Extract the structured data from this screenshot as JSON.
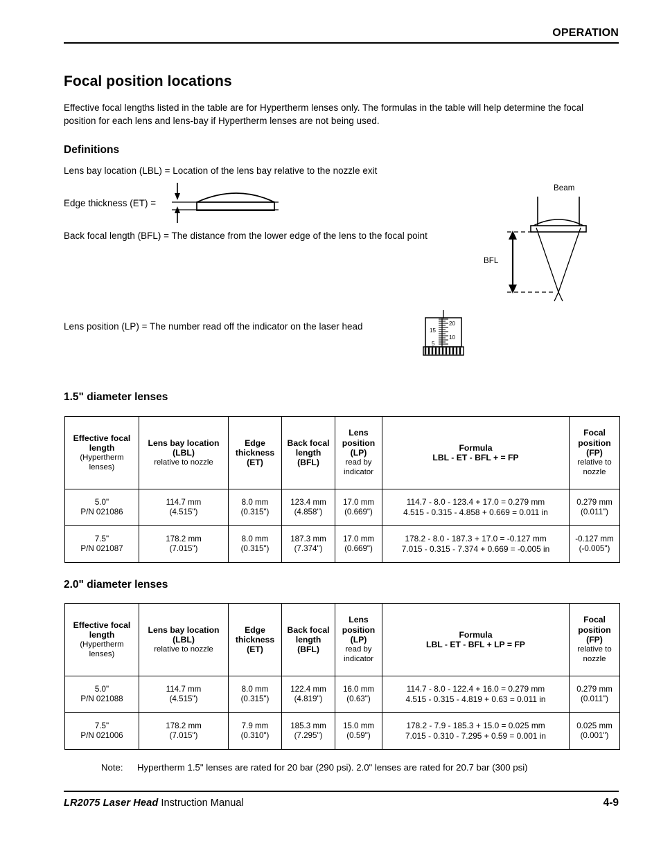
{
  "header": {
    "section_title": "OPERATION"
  },
  "titles": {
    "h1": "Focal position locations",
    "definitions": "Definitions",
    "table1_heading": "1.5\" diameter lenses",
    "table2_heading": "2.0\" diameter lenses"
  },
  "intro": {
    "paragraph": "Effective focal lengths listed in the table are for Hypertherm lenses only. The formulas in the table will help determine the focal position for each lens and lens-bay if Hypertherm lenses are not being used."
  },
  "definitions": {
    "lbl": "Lens bay location (LBL) = Location of the lens bay relative to the nozzle exit",
    "et": "Edge thickness (ET) =",
    "bfl": "Back focal length (BFL) = The distance from the lower edge of the lens to the focal point",
    "lp": "Lens position (LP) = The number read off the indicator on the laser head"
  },
  "diagrams": {
    "beam_label": "Beam",
    "bfl_label": "BFL",
    "indicator_ticks": [
      "20",
      "15",
      "10",
      "5"
    ]
  },
  "columns": {
    "efl_line1": "Effective focal",
    "efl_line2": "length",
    "efl_line3": "(Hypertherm",
    "efl_line4": "lenses)",
    "lbl_line1": "Lens bay location",
    "lbl_line2": "(LBL)",
    "lbl_line3": "relative to nozzle",
    "et_line1": "Edge",
    "et_line2": "thickness",
    "et_line3": "(ET)",
    "bfl_line1": "Back focal",
    "bfl_line2": "length",
    "bfl_line3": "(BFL)",
    "lp_line1": "Lens",
    "lp_line2": "position",
    "lp_line3": "(LP)",
    "lp_line4": "read by",
    "lp_line5": "indicator",
    "formula_line1": "Formula",
    "fp_line1": "Focal",
    "fp_line2": "position",
    "fp_line3": "(FP)",
    "fp_line4": "relative to",
    "fp_line5": "nozzle"
  },
  "table1": {
    "formula_header": "LBL - ET - BFL + = FP",
    "rows": [
      {
        "efl_a": "5.0\"",
        "efl_b": "P/N 021086",
        "lbl_a": "114.7 mm",
        "lbl_b": "(4.515\")",
        "et_a": "8.0 mm",
        "et_b": "(0.315\")",
        "bfl_a": "123.4 mm",
        "bfl_b": "(4.858\")",
        "lp_a": "17.0 mm",
        "lp_b": "(0.669\")",
        "formula_mm": "114.7 - 8.0 - 123.4 + 17.0 = 0.279 mm",
        "formula_in": "4.515 - 0.315 - 4.858 + 0.669 = 0.011 in",
        "fp_a": "0.279 mm",
        "fp_b": "(0.011\")"
      },
      {
        "efl_a": "7.5\"",
        "efl_b": "P/N 021087",
        "lbl_a": "178.2 mm",
        "lbl_b": "(7.015\")",
        "et_a": "8.0 mm",
        "et_b": "(0.315\")",
        "bfl_a": "187.3 mm",
        "bfl_b": "(7.374\")",
        "lp_a": "17.0 mm",
        "lp_b": "(0.669\")",
        "formula_mm": "178.2 - 8.0 - 187.3 + 17.0 = -0.127 mm",
        "formula_in": "7.015 - 0.315 - 7.374 + 0.669 = -0.005 in",
        "fp_a": "-0.127 mm",
        "fp_b": "(-0.005\")"
      }
    ]
  },
  "table2": {
    "formula_header": "LBL - ET - BFL + LP = FP",
    "rows": [
      {
        "efl_a": "5.0\"",
        "efl_b": "P/N 021088",
        "lbl_a": "114.7 mm",
        "lbl_b": "(4.515\")",
        "et_a": "8.0 mm",
        "et_b": "(0.315\")",
        "bfl_a": "122.4 mm",
        "bfl_b": "(4.819\")",
        "lp_a": "16.0 mm",
        "lp_b": "(0.63\")",
        "formula_mm": "114.7 - 8.0 - 122.4 + 16.0 = 0.279 mm",
        "formula_in": "4.515 - 0.315 - 4.819 + 0.63 = 0.011 in",
        "fp_a": "0.279 mm",
        "fp_b": "(0.011\")"
      },
      {
        "efl_a": "7.5\"",
        "efl_b": "P/N 021006",
        "lbl_a": "178.2 mm",
        "lbl_b": "(7.015\")",
        "et_a": "7.9 mm",
        "et_b": "(0.310\")",
        "bfl_a": "185.3 mm",
        "bfl_b": "(7.295\")",
        "lp_a": "15.0 mm",
        "lp_b": "(0.59\")",
        "formula_mm": "178.2 - 7.9 - 185.3 + 15.0 = 0.025 mm",
        "formula_in": "7.015 - 0.310 - 7.295 + 0.59 = 0.001 in",
        "fp_a": "0.025 mm",
        "fp_b": "(0.001\")"
      }
    ]
  },
  "note": {
    "label": "Note:",
    "text": "Hypertherm 1.5\" lenses are rated for 20 bar (290 psi). 2.0\" lenses are rated for 20.7 bar (300 psi)"
  },
  "footer": {
    "product": "LR2075 Laser Head",
    "manual": "Instruction Manual",
    "page": "4-9"
  }
}
